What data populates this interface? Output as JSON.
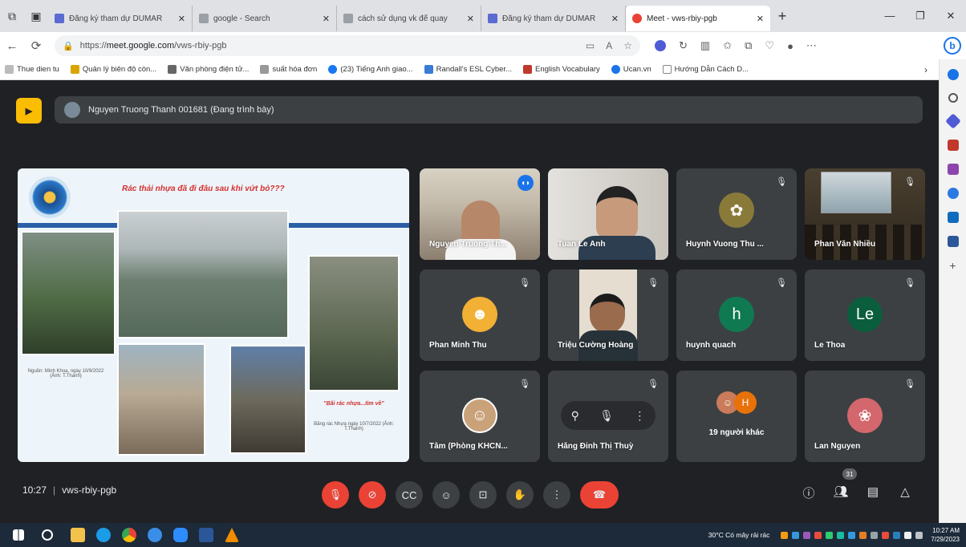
{
  "browser": {
    "tabs": [
      {
        "label": "Đăng ký tham dự DUMAR",
        "active": false,
        "color": "#5b6bd1"
      },
      {
        "label": "google - Search",
        "active": false,
        "color": "#9aa0a6"
      },
      {
        "label": "cách sử dụng vk để quay",
        "active": false,
        "color": "#9aa0a6"
      },
      {
        "label": "Đăng ký tham dự DUMAR",
        "active": false,
        "color": "#5b6bd1"
      },
      {
        "label": "Meet - vws-rbiy-pgb",
        "active": true,
        "color": "#ea4335"
      }
    ],
    "url_prefix": "https://",
    "url_host": "meet.google.com",
    "url_path": "/vws-rbiy-pgb",
    "bookmarks": [
      "Thue dien tu",
      "Quản lý biên độ còn...",
      "Văn phòng điện tử...",
      "suất hóa đơn",
      "(23) Tiếng Anh giao...",
      "Randall's ESL Cyber...",
      "English Vocabulary",
      "Ucan.vn",
      "Hướng Dẫn Cách D..."
    ]
  },
  "meet": {
    "presenter_banner": "Nguyen Truong Thanh 001681 (Đang trình bày)",
    "slide": {
      "title": "Rác thải nhựa đã đi đâu sau khi vứt bỏ???",
      "red_caption": "\"Bãi rác nhựa...tìm về\"",
      "caption_left": "Nguồn: Minh Khoa, ngày 10/9/2022 (Ảnh: T.Thanh)",
      "caption_right": "Bãng rác Nhựa ngày 10/7/2022 (Ảnh: T.Thanh)"
    },
    "tiles": [
      {
        "name": "Nguyen Truong Th...",
        "type": "video-speaking"
      },
      {
        "name": "Tuan Le Anh",
        "type": "video"
      },
      {
        "name": "Huynh Vuong Thu ...",
        "type": "avatar-photo",
        "color": "#8a7a3a"
      },
      {
        "name": "Phan Văn Nhiều",
        "type": "video-room"
      },
      {
        "name": "Phan Minh Thu",
        "type": "avatar-photo",
        "color": "#f2b134"
      },
      {
        "name": "Triệu Cường Hoàng",
        "type": "video-person"
      },
      {
        "name": "huynh quach",
        "type": "letter",
        "letter": "h",
        "color": "#0f7a52"
      },
      {
        "name": "Le Thoa",
        "type": "letter",
        "letter": "Le",
        "color": "#0b5e3d"
      },
      {
        "name": "Tâm (Phòng KHCN...",
        "type": "avatar-photo",
        "color": "#c9a27a"
      },
      {
        "name": "Hằng Đinh Thị Thuỳ",
        "type": "hover"
      },
      {
        "name": "19 người khác",
        "type": "others",
        "letter": "H",
        "color": "#e8710a"
      },
      {
        "name": "Lan Nguyen",
        "type": "avatar-photo",
        "color": "#d3676d"
      }
    ],
    "time": "10:27",
    "meeting_code": "vws-rbiy-pgb",
    "participant_count": "31"
  },
  "taskbar": {
    "weather": "30°C  Có mây rải rác",
    "time": "10:27 AM",
    "date": "7/29/2023"
  }
}
